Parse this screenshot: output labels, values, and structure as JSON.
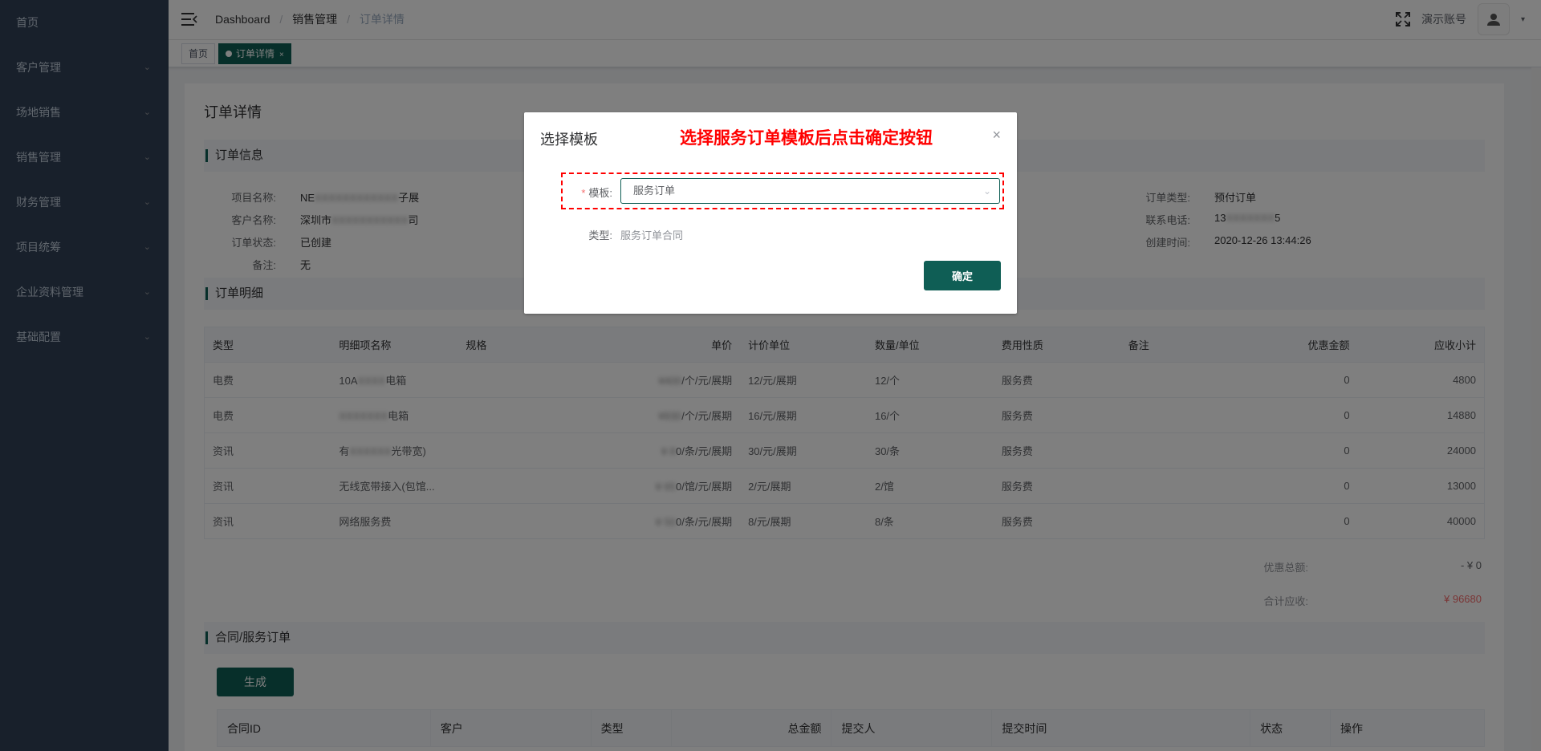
{
  "sidebar": {
    "items": [
      {
        "label": "首页",
        "has_arrow": false
      },
      {
        "label": "客户管理",
        "has_arrow": true
      },
      {
        "label": "场地销售",
        "has_arrow": true
      },
      {
        "label": "销售管理",
        "has_arrow": true
      },
      {
        "label": "财务管理",
        "has_arrow": true
      },
      {
        "label": "项目统筹",
        "has_arrow": true
      },
      {
        "label": "企业资料管理",
        "has_arrow": true
      },
      {
        "label": "基础配置",
        "has_arrow": true
      }
    ],
    "arrow_glyph": "⌄"
  },
  "header": {
    "breadcrumb": [
      "Dashboard",
      "销售管理",
      "订单详情"
    ],
    "separator": "/",
    "account_name": "演示账号",
    "caret": "▾"
  },
  "tags": {
    "home": "首页",
    "active": "订单详情",
    "close": "×"
  },
  "page": {
    "title": "订单详情",
    "order_info_title": "订单信息",
    "order_detail_title": "订单明细",
    "contract_title": "合同/服务订单"
  },
  "order_info": {
    "project_name_label": "项目名称:",
    "project_name_prefix": "NE",
    "project_name_blur": "XXXXXXXXXXXX",
    "project_name_suffix": "子展",
    "customer_label": "客户名称:",
    "customer_prefix": "深圳市",
    "customer_blur": "XXXXXXXXXXX",
    "customer_suffix": "司",
    "status_label": "订单状态:",
    "status_value": "已创建",
    "remark_label": "备注:",
    "remark_value": "无",
    "order_type_label": "订单类型:",
    "order_type_value": "预付订单",
    "phone_label": "联系电话:",
    "phone_prefix": "13",
    "phone_blur": "XXXXXXX",
    "phone_suffix": "5",
    "created_label": "创建时间:",
    "created_value": "2020-12-26 13:44:26"
  },
  "detail_table": {
    "headers": [
      "类型",
      "明细项名称",
      "规格",
      "单价",
      "计价单位",
      "数量/单位",
      "费用性质",
      "备注",
      "优惠金额",
      "应收小计"
    ],
    "rows": [
      {
        "type": "电费",
        "name_a": "10A",
        "name_blur": "XXXX",
        "name_b": "电箱",
        "price_blur": "¥400",
        "price_suffix": "/个/元/展期",
        "unit": "12/元/展期",
        "qty": "12/个",
        "nature": "服务费",
        "remark": "",
        "discount": "0",
        "subtotal": "4800"
      },
      {
        "type": "电费",
        "name_a": "",
        "name_blur": "XXXXXXX",
        "name_b": "电箱",
        "price_blur": "¥930",
        "price_suffix": "/个/元/展期",
        "unit": "16/元/展期",
        "qty": "16/个",
        "nature": "服务费",
        "remark": "",
        "discount": "0",
        "subtotal": "14880"
      },
      {
        "type": "资讯",
        "name_a": "有",
        "name_blur": "XXXXXX",
        "name_b": "光带宽)",
        "price_blur": "¥ 8",
        "price_suffix": "0/条/元/展期",
        "unit": "30/元/展期",
        "qty": "30/条",
        "nature": "服务费",
        "remark": "",
        "discount": "0",
        "subtotal": "24000"
      },
      {
        "type": "资讯",
        "name_a": "无线宽带接入(包馆...",
        "name_blur": "",
        "name_b": "",
        "price_blur": "¥ 65",
        "price_suffix": "0/馆/元/展期",
        "unit": "2/元/展期",
        "qty": "2/馆",
        "nature": "服务费",
        "remark": "",
        "discount": "0",
        "subtotal": "13000"
      },
      {
        "type": "资讯",
        "name_a": "网络服务费",
        "name_blur": "",
        "name_b": "",
        "price_blur": "¥ 50",
        "price_suffix": "0/条/元/展期",
        "unit": "8/元/展期",
        "qty": "8/条",
        "nature": "服务费",
        "remark": "",
        "discount": "0",
        "subtotal": "40000"
      }
    ]
  },
  "summary": {
    "discount_label": "优惠总额:",
    "discount_value": "- ¥ 0",
    "total_label": "合计应收:",
    "total_value": "¥ 96680",
    "total_color": "#f56c6c"
  },
  "contract": {
    "generate_label": "生成",
    "headers": [
      "合同ID",
      "客户",
      "类型",
      "总金额",
      "提交人",
      "提交时间",
      "状态",
      "操作"
    ]
  },
  "dialog": {
    "title": "选择模板",
    "instruction": "选择服务订单模板后点击确定按钮",
    "close": "×",
    "template_label": "模板:",
    "required_mark": "*",
    "template_value": "服务订单",
    "chevron": "⌄",
    "type_label": "类型:",
    "type_value": "服务订单合同",
    "confirm_label": "确定"
  },
  "colors": {
    "accent": "#0f5e55",
    "sidebar_bg": "#304156",
    "annotation_red": "#ff0000"
  }
}
